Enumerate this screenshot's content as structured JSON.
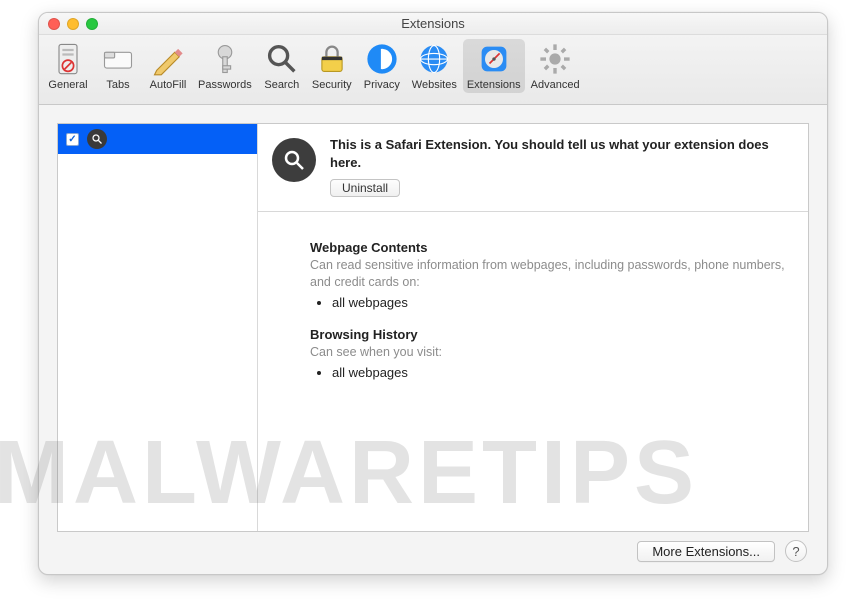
{
  "window_title": "Extensions",
  "toolbar": {
    "items": [
      {
        "label": "General"
      },
      {
        "label": "Tabs"
      },
      {
        "label": "AutoFill"
      },
      {
        "label": "Passwords"
      },
      {
        "label": "Search"
      },
      {
        "label": "Security"
      },
      {
        "label": "Privacy"
      },
      {
        "label": "Websites"
      },
      {
        "label": "Extensions"
      },
      {
        "label": "Advanced"
      }
    ],
    "selected_index": 8
  },
  "sidebar": {
    "selected_ext": {
      "checked": true,
      "checkmark": "✓",
      "name": ""
    }
  },
  "detail": {
    "description": "This is a Safari Extension. You should tell us what your extension does here.",
    "uninstall_label": "Uninstall",
    "permissions": [
      {
        "title": "Webpage Contents",
        "subtitle": "Can read sensitive information from webpages, including passwords, phone numbers, and credit cards on:",
        "items": [
          "all webpages"
        ]
      },
      {
        "title": "Browsing History",
        "subtitle": "Can see when you visit:",
        "items": [
          "all webpages"
        ]
      }
    ]
  },
  "footer": {
    "more_label": "More Extensions...",
    "help_label": "?"
  },
  "watermark": "MALWARETIPS"
}
